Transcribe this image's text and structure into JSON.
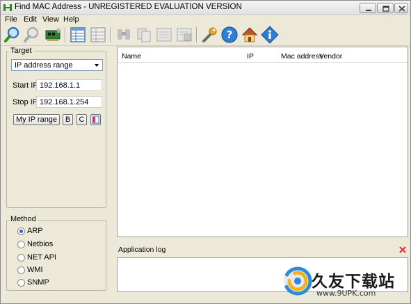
{
  "window": {
    "title": "Find MAC Address - UNREGISTERED EVALUATION VERSION"
  },
  "menu": {
    "items": [
      {
        "label": "File"
      },
      {
        "label": "Edit"
      },
      {
        "label": "View"
      },
      {
        "label": "Help"
      }
    ]
  },
  "toolbar": {
    "buttons": [
      {
        "icon": "find-icon",
        "enabled": true
      },
      {
        "icon": "stop-search-icon",
        "enabled": false
      },
      {
        "icon": "network-card-icon",
        "enabled": true
      },
      {
        "icon": "table-view-icon",
        "enabled": true
      },
      {
        "icon": "table-export-icon",
        "enabled": false
      },
      {
        "icon": "binoculars-icon",
        "enabled": false
      },
      {
        "icon": "copy-icon",
        "enabled": false
      },
      {
        "icon": "report-icon",
        "enabled": false
      },
      {
        "icon": "save-report-icon",
        "enabled": false
      },
      {
        "icon": "wrench-icon",
        "enabled": true
      },
      {
        "icon": "help-icon",
        "enabled": true
      },
      {
        "icon": "home-icon",
        "enabled": true
      },
      {
        "icon": "info-icon",
        "enabled": true
      }
    ]
  },
  "target": {
    "group_label": "Target",
    "mode_selected": "IP address range",
    "start_label": "Start IP:",
    "start_value": "192.168.1.1",
    "stop_label": "Stop IP:",
    "stop_value": "192.168.1.254",
    "my_ip_range_label": "My IP range",
    "b_label": "B",
    "c_label": "C"
  },
  "method": {
    "group_label": "Method",
    "options": [
      {
        "label": "ARP",
        "checked": true
      },
      {
        "label": "Netbios",
        "checked": false
      },
      {
        "label": "NET API",
        "checked": false
      },
      {
        "label": "WMI",
        "checked": false
      },
      {
        "label": "SNMP",
        "checked": false
      }
    ]
  },
  "results": {
    "columns": [
      "Name",
      "IP",
      "Mac address",
      "Vendor"
    ],
    "rows": []
  },
  "log": {
    "label": "Application log"
  },
  "watermark": {
    "text": "久友下载站",
    "url": "www.9UPK.com"
  },
  "colors": {
    "window_bg": "#ece9d8",
    "accent_blue": "#2a63d6",
    "close_red": "#e03030"
  }
}
